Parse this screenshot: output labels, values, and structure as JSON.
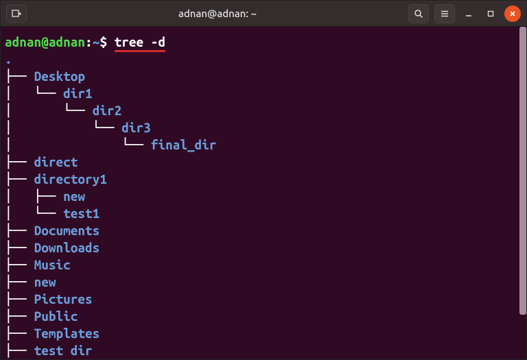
{
  "titlebar": {
    "title": "adnan@adnan: ~"
  },
  "prompt": {
    "userhost": "adnan@adnan",
    "colon": ":",
    "path": "~",
    "dollar": "$",
    "command": "tree -d"
  },
  "tree": {
    "root_dot": ".",
    "lines": [
      {
        "branch": "├── ",
        "name": "Desktop"
      },
      {
        "branch": "│   └── ",
        "name": "dir1"
      },
      {
        "branch": "│       └── ",
        "name": "dir2"
      },
      {
        "branch": "│           └── ",
        "name": "dir3"
      },
      {
        "branch": "│               └── ",
        "name": "final_dir"
      },
      {
        "branch": "├── ",
        "name": "direct"
      },
      {
        "branch": "├── ",
        "name": "directory1"
      },
      {
        "branch": "│   ├── ",
        "name": "new"
      },
      {
        "branch": "│   └── ",
        "name": "test1"
      },
      {
        "branch": "├── ",
        "name": "Documents"
      },
      {
        "branch": "├── ",
        "name": "Downloads"
      },
      {
        "branch": "├── ",
        "name": "Music"
      },
      {
        "branch": "├── ",
        "name": "new"
      },
      {
        "branch": "├── ",
        "name": "Pictures"
      },
      {
        "branch": "├── ",
        "name": "Public"
      },
      {
        "branch": "├── ",
        "name": "Templates"
      },
      {
        "branch": "├── ",
        "name": "test dir"
      }
    ]
  }
}
